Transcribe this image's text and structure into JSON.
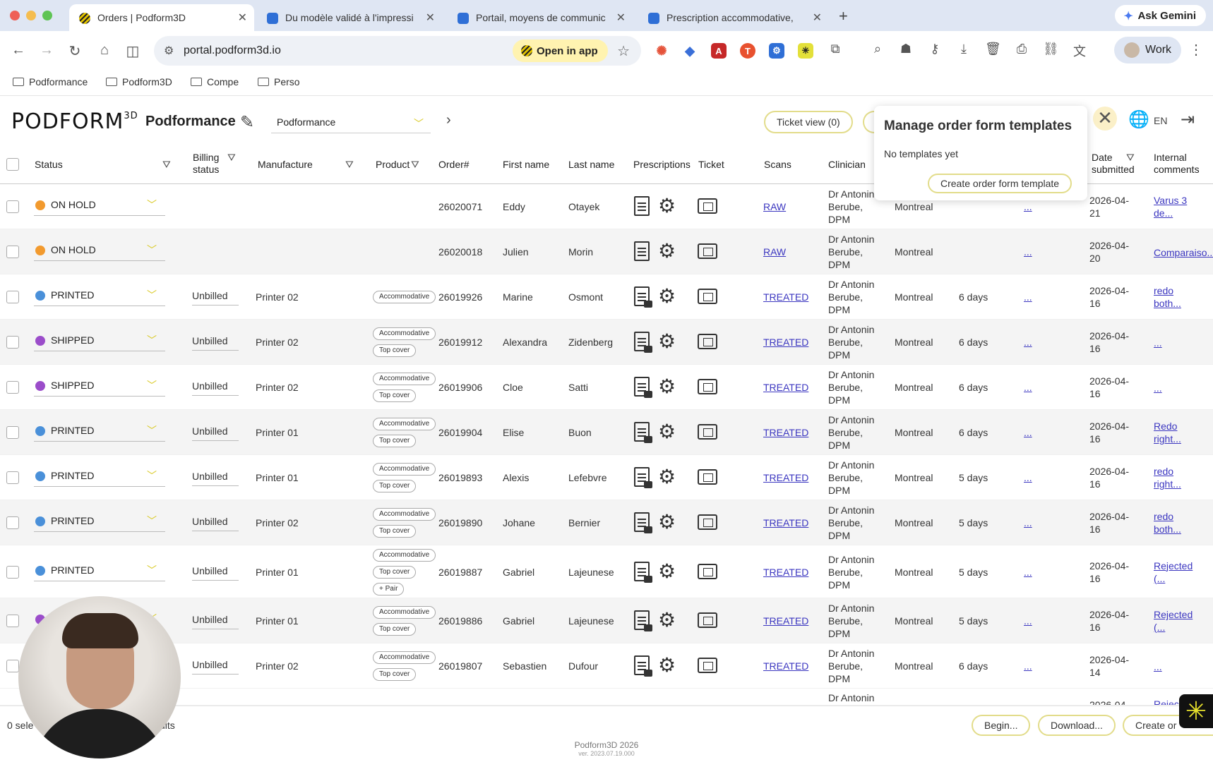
{
  "browser": {
    "tabs": [
      {
        "title": "Orders | Podform3D",
        "active": true
      },
      {
        "title": "Du modèle validé à l'impressi",
        "active": false
      },
      {
        "title": "Portail, moyens de communic",
        "active": false
      },
      {
        "title": "Prescription accommodative,",
        "active": false
      }
    ],
    "ask_gemini": "Ask Gemini",
    "url": "portal.podform3d.io",
    "open_in_app": "Open in app",
    "profile": "Work",
    "bookmarks": [
      "Podformance",
      "Podform3D",
      "Compe",
      "Perso"
    ]
  },
  "app": {
    "logo": "PODFORM",
    "logo_sup": "3D",
    "org_title": "Podformance",
    "org_select": "Podformance",
    "ticket_view": "Ticket view (0)",
    "lang": "EN"
  },
  "popup": {
    "title": "Manage order form templates",
    "empty": "No templates yet",
    "button": "Create order form template"
  },
  "columns": {
    "status": "Status",
    "billing": "Billing status",
    "manufacture": "Manufacture",
    "product": "Product",
    "order": "Order#",
    "first": "First name",
    "last": "Last name",
    "prescriptions": "Prescriptions",
    "ticket": "Ticket",
    "scans": "Scans",
    "clinician": "Clinician",
    "date": "Date submitted",
    "comments": "Internal comments"
  },
  "rows": [
    {
      "status": "ON HOLD",
      "dot": "#f29a2e",
      "billing": "",
      "manufacture": "",
      "chips": [],
      "order": "26020071",
      "first": "Eddy",
      "last": "Otayek",
      "scan": "RAW",
      "clinician": [
        "Dr Antonin",
        "Berube,",
        "DPM"
      ],
      "city": "Montreal",
      "delay": "",
      "more": "...",
      "date": [
        "2026-04-",
        "21"
      ],
      "comment": [
        "Varus 3",
        "de..."
      ]
    },
    {
      "status": "ON HOLD",
      "dot": "#f29a2e",
      "billing": "",
      "manufacture": "",
      "chips": [],
      "order": "26020018",
      "first": "Julien",
      "last": "Morin",
      "scan": "RAW",
      "clinician": [
        "Dr Antonin",
        "Berube,",
        "DPM"
      ],
      "city": "Montreal",
      "delay": "",
      "more": "...",
      "date": [
        "2026-04-",
        "20"
      ],
      "comment": [
        "Comparaiso..."
      ]
    },
    {
      "status": "PRINTED",
      "dot": "#4a90d9",
      "billing": "Unbilled",
      "manufacture": "Printer 02",
      "chips": [
        "Accommodative"
      ],
      "order": "26019926",
      "first": "Marine",
      "last": "Osmont",
      "scan": "TREATED",
      "clinician": [
        "Dr Antonin",
        "Berube,",
        "DPM"
      ],
      "city": "Montreal",
      "delay": "6 days",
      "more": "...",
      "date": [
        "2026-04-",
        "16"
      ],
      "comment": [
        "redo",
        "both..."
      ]
    },
    {
      "status": "SHIPPED",
      "dot": "#9b4dca",
      "billing": "Unbilled",
      "manufacture": "Printer 02",
      "chips": [
        "Accommodative",
        "Top cover"
      ],
      "order": "26019912",
      "first": "Alexandra",
      "last": "Zidenberg",
      "scan": "TREATED",
      "clinician": [
        "Dr Antonin",
        "Berube,",
        "DPM"
      ],
      "city": "Montreal",
      "delay": "6 days",
      "more": "...",
      "date": [
        "2026-04-",
        "16"
      ],
      "comment": [
        "..."
      ]
    },
    {
      "status": "SHIPPED",
      "dot": "#9b4dca",
      "billing": "Unbilled",
      "manufacture": "Printer 02",
      "chips": [
        "Accommodative",
        "Top cover"
      ],
      "order": "26019906",
      "first": "Cloe",
      "last": "Satti",
      "scan": "TREATED",
      "clinician": [
        "Dr Antonin",
        "Berube,",
        "DPM"
      ],
      "city": "Montreal",
      "delay": "6 days",
      "more": "...",
      "date": [
        "2026-04-",
        "16"
      ],
      "comment": [
        "..."
      ]
    },
    {
      "status": "PRINTED",
      "dot": "#4a90d9",
      "billing": "Unbilled",
      "manufacture": "Printer 01",
      "chips": [
        "Accommodative",
        "Top cover"
      ],
      "order": "26019904",
      "first": "Elise",
      "last": "Buon",
      "scan": "TREATED",
      "clinician": [
        "Dr Antonin",
        "Berube,",
        "DPM"
      ],
      "city": "Montreal",
      "delay": "6 days",
      "more": "...",
      "date": [
        "2026-04-",
        "16"
      ],
      "comment": [
        "Redo",
        "right..."
      ]
    },
    {
      "status": "PRINTED",
      "dot": "#4a90d9",
      "billing": "Unbilled",
      "manufacture": "Printer 01",
      "chips": [
        "Accommodative",
        "Top cover"
      ],
      "order": "26019893",
      "first": "Alexis",
      "last": "Lefebvre",
      "scan": "TREATED",
      "clinician": [
        "Dr Antonin",
        "Berube,",
        "DPM"
      ],
      "city": "Montreal",
      "delay": "5 days",
      "more": "...",
      "date": [
        "2026-04-",
        "16"
      ],
      "comment": [
        "redo",
        "right..."
      ]
    },
    {
      "status": "PRINTED",
      "dot": "#4a90d9",
      "billing": "Unbilled",
      "manufacture": "Printer 02",
      "chips": [
        "Accommodative",
        "Top cover"
      ],
      "order": "26019890",
      "first": "Johane",
      "last": "Bernier",
      "scan": "TREATED",
      "clinician": [
        "Dr Antonin",
        "Berube,",
        "DPM"
      ],
      "city": "Montreal",
      "delay": "5 days",
      "more": "...",
      "date": [
        "2026-04-",
        "16"
      ],
      "comment": [
        "redo",
        "both..."
      ]
    },
    {
      "status": "PRINTED",
      "dot": "#4a90d9",
      "billing": "Unbilled",
      "manufacture": "Printer 01",
      "chips": [
        "Accommodative",
        "Top cover",
        "+ Pair"
      ],
      "order": "26019887",
      "first": "Gabriel",
      "last": "Lajeunese",
      "scan": "TREATED",
      "clinician": [
        "Dr Antonin",
        "Berube,",
        "DPM"
      ],
      "city": "Montreal",
      "delay": "5 days",
      "more": "...",
      "date": [
        "2026-04-",
        "16"
      ],
      "comment": [
        "Rejected",
        "(..."
      ]
    },
    {
      "status": "",
      "dot": "#9b4dca",
      "billing": "Unbilled",
      "manufacture": "Printer 01",
      "chips": [
        "Accommodative",
        "Top cover"
      ],
      "order": "26019886",
      "first": "Gabriel",
      "last": "Lajeunese",
      "scan": "TREATED",
      "clinician": [
        "Dr Antonin",
        "Berube,",
        "DPM"
      ],
      "city": "Montreal",
      "delay": "5 days",
      "more": "...",
      "date": [
        "2026-04-",
        "16"
      ],
      "comment": [
        "Rejected",
        "(..."
      ]
    },
    {
      "status": "",
      "dot": "#4a90d9",
      "billing": "Unbilled",
      "manufacture": "Printer 02",
      "chips": [
        "Accommodative",
        "Top cover"
      ],
      "order": "26019807",
      "first": "Sebastien",
      "last": "Dufour",
      "scan": "TREATED",
      "clinician": [
        "Dr Antonin",
        "Berube,",
        "DPM"
      ],
      "city": "Montreal",
      "delay": "6 days",
      "more": "...",
      "date": [
        "2026-04-",
        "14"
      ],
      "comment": [
        "..."
      ]
    }
  ],
  "partial_row": {
    "clinician": "Dr Antonin",
    "date": "2026-04-",
    "comment": "Rejec"
  },
  "footer": {
    "selected": "0 sele",
    "results": "ults",
    "begin": "Begin...",
    "download": "Download...",
    "create": "Create or",
    "copyright": "Podform3D 2026",
    "version": "ver. 2023.07.19.000"
  }
}
